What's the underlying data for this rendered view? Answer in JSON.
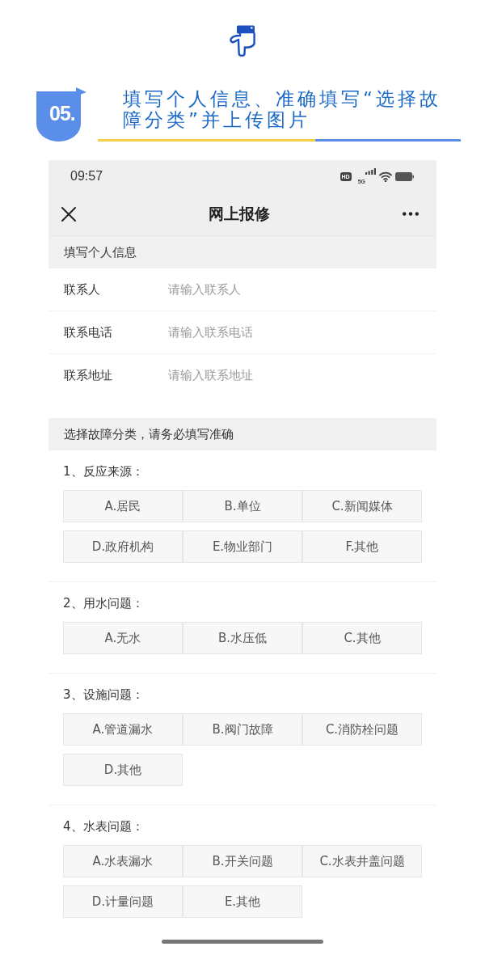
{
  "banner": {
    "step": "05.",
    "title": "填写个人信息、准确填写“选择故障分类”并上传图片"
  },
  "status_bar": {
    "time": "09:57",
    "hd": "HD",
    "network": "5G"
  },
  "nav_bar": {
    "title": "网上报修"
  },
  "contact_section": {
    "title": "填写个人信息",
    "fields": [
      {
        "label": "联系人",
        "placeholder": "请输入联系人"
      },
      {
        "label": "联系电话",
        "placeholder": "请输入联系电话"
      },
      {
        "label": "联系地址",
        "placeholder": "请输入联系地址"
      }
    ]
  },
  "fault_section": {
    "title": "选择故障分类，请务必填写准确",
    "questions": [
      {
        "title": "1、反应来源：",
        "options": [
          {
            "label": "A.居民",
            "selected": false
          },
          {
            "label": "B.单位",
            "selected": false
          },
          {
            "label": "C.新闻媒体",
            "selected": false
          },
          {
            "label": "D.政府机构",
            "selected": false
          },
          {
            "label": "E.物业部门",
            "selected": false
          },
          {
            "label": "F.其他",
            "selected": false
          }
        ]
      },
      {
        "title": "2、用水问题：",
        "options": [
          {
            "label": "A.无水",
            "selected": false
          },
          {
            "label": "B.水压低",
            "selected": false
          },
          {
            "label": "C.其他",
            "selected": false
          }
        ]
      },
      {
        "title": "3、设施问题：",
        "options": [
          {
            "label": "A.管道漏水",
            "selected": false
          },
          {
            "label": "B.阀门故障",
            "selected": false
          },
          {
            "label": "C.消防栓问题",
            "selected": false
          },
          {
            "label": "D.其他",
            "selected": false
          }
        ]
      },
      {
        "title": "4、水表问题：",
        "options": [
          {
            "label": "A.水表漏水",
            "selected": false
          },
          {
            "label": "B.开关问题",
            "selected": false
          },
          {
            "label": "C.水表井盖问题",
            "selected": false
          },
          {
            "label": "D.计量问题",
            "selected": false
          },
          {
            "label": "E.其他",
            "selected": false
          }
        ]
      }
    ]
  }
}
